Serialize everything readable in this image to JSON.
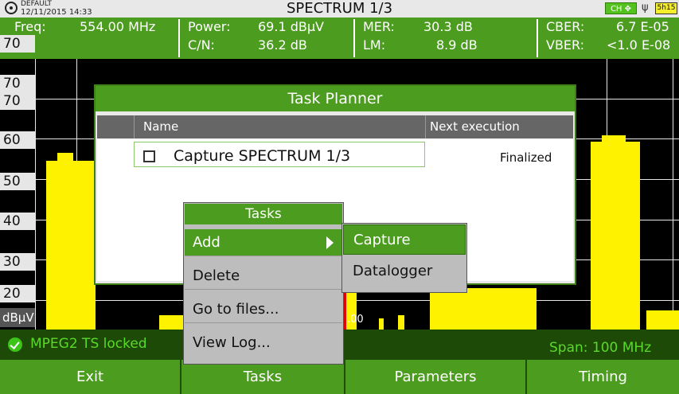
{
  "header": {
    "profile": "DEFAULT",
    "datetime": "12/11/2015 14:33",
    "title": "SPECTRUM 1/3",
    "ch_badge": "CH",
    "battery": "5h15"
  },
  "measurements": {
    "freq_label": "Freq:",
    "freq_value": "554.00 MHz",
    "power_label": "Power:",
    "power_value": "69.1 dBµV",
    "cn_label": "C/N:",
    "cn_value": "36.2 dB",
    "mer_label": "MER:",
    "mer_value": "30.3 dB",
    "lm_label": "LM:",
    "lm_value": "8.9 dB",
    "cber_label": "CBER:",
    "cber_value": "6.7 E-05",
    "vber_label": "VBER:",
    "vber_value": "<1.0 E-08"
  },
  "chart": {
    "y_ticks": [
      "70",
      "60",
      "50",
      "40",
      "30",
      "20"
    ],
    "unit": "dBµV",
    "marker_label": ".00"
  },
  "status": {
    "lock_text": "MPEG2 TS locked",
    "span_text": "Span: 100 MHz"
  },
  "softkeys": [
    "Exit",
    "Tasks",
    "Parameters",
    "Timing"
  ],
  "planner": {
    "title": "Task Planner",
    "col_name": "Name",
    "col_next": "Next execution",
    "task_name": "Capture SPECTRUM 1/3",
    "task_status": "Finalized"
  },
  "menu": {
    "title": "Tasks",
    "items": [
      "Add",
      "Delete",
      "Go to files...",
      "View Log..."
    ]
  },
  "submenu": {
    "items": [
      "Capture",
      "Datalogger"
    ]
  },
  "colors": {
    "accent_green": "#4c9d1f",
    "trace_yellow": "#fff200",
    "status_green": "#5bd92a"
  }
}
